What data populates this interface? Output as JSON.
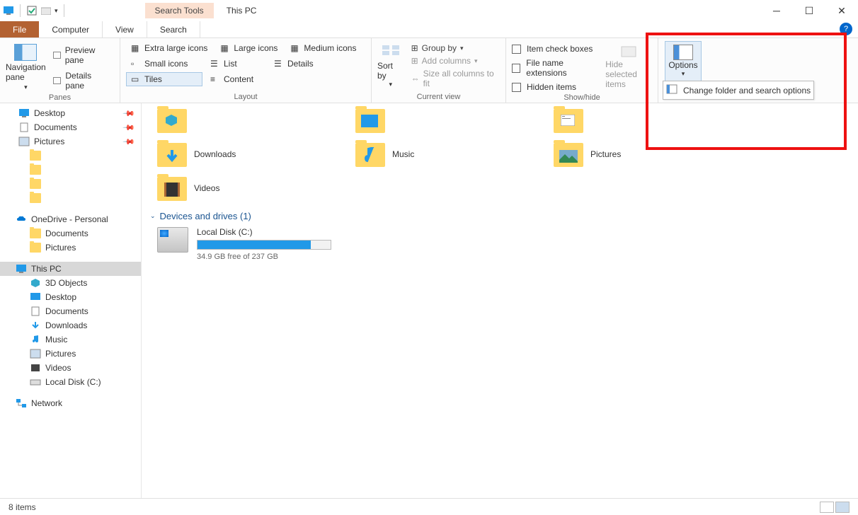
{
  "title": "This PC",
  "search_tools": "Search Tools",
  "tabs": {
    "file": "File",
    "computer": "Computer",
    "view": "View",
    "search": "Search"
  },
  "ribbon": {
    "panes": {
      "label": "Panes",
      "nav": "Navigation pane",
      "preview": "Preview pane",
      "details": "Details pane"
    },
    "layout": {
      "label": "Layout",
      "xl": "Extra large icons",
      "lg": "Large icons",
      "md": "Medium icons",
      "sm": "Small icons",
      "list": "List",
      "details": "Details",
      "tiles": "Tiles",
      "content": "Content"
    },
    "current": {
      "label": "Current view",
      "sort": "Sort by",
      "group": "Group by",
      "addcols": "Add columns",
      "fit": "Size all columns to fit"
    },
    "showhide": {
      "label": "Show/hide",
      "itemcheck": "Item check boxes",
      "ext": "File name extensions",
      "hidden": "Hidden items",
      "hidesel": "Hide selected items"
    },
    "options": {
      "btn": "Options",
      "change": "Change folder and search options"
    }
  },
  "tree": {
    "desktop": "Desktop",
    "documents": "Documents",
    "pictures": "Pictures",
    "onedrive": "OneDrive - Personal",
    "thispc": "This PC",
    "obj3d": "3D Objects",
    "downloads": "Downloads",
    "music": "Music",
    "videos": "Videos",
    "localdisk": "Local Disk (C:)",
    "network": "Network"
  },
  "folders": {
    "downloads": "Downloads",
    "music": "Music",
    "pictures": "Pictures",
    "videos": "Videos"
  },
  "devices": {
    "header": "Devices and drives (1)",
    "drive": {
      "name": "Local Disk (C:)",
      "free": "34.9 GB free of 237 GB",
      "fill_pct": 85
    }
  },
  "status": {
    "items": "8 items"
  }
}
